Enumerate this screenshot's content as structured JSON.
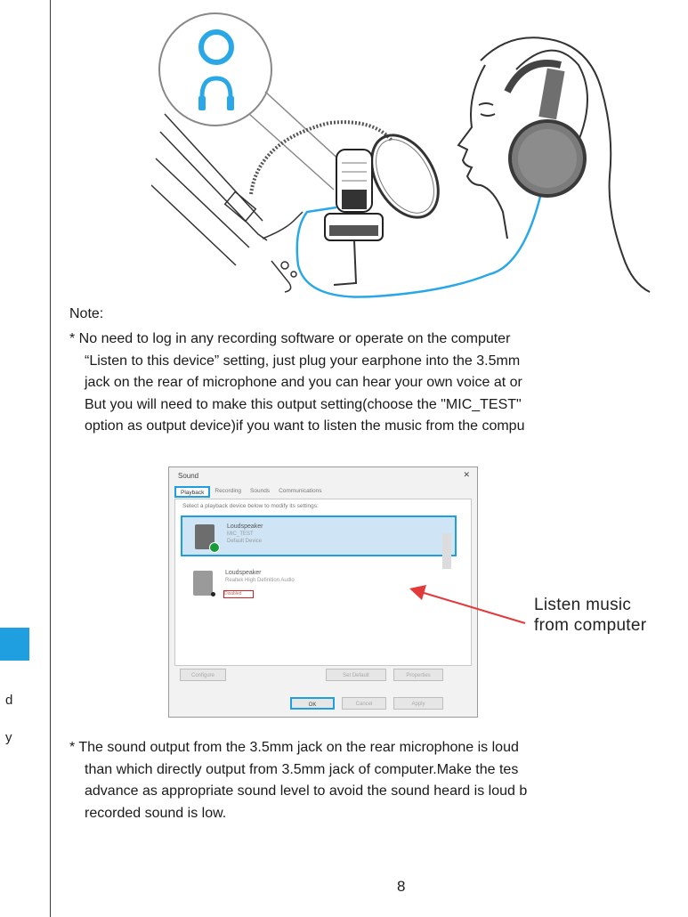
{
  "left_column": {
    "fragment_1": "d",
    "fragment_2": "y"
  },
  "note_heading": "Note:",
  "note_lines": [
    "* No need to log in any recording software or operate on the computer",
    "“Listen to this device” setting, just plug your earphone into the 3.5mm",
    "jack on the rear of microphone and you can hear your own voice at or",
    "But you will need to make this output setting(choose the \"MIC_TEST\"",
    "option as output device)if you want to listen the music from the compu"
  ],
  "dialog": {
    "title": "Sound",
    "close": "✕",
    "tabs": [
      "Playback",
      "Recording",
      "Sounds",
      "Communications"
    ],
    "instruction": "Select a playback device below to modify its settings:",
    "devices": [
      {
        "name": "Loudspeaker",
        "line2": "MIC_TEST",
        "line3": "Default Device"
      },
      {
        "name": "Loudspeaker",
        "line2": "Realtek High Definition Audio",
        "line3": "Disabled"
      }
    ],
    "buttons": {
      "configure": "Configure",
      "set_default": "Set Default",
      "properties": "Properties",
      "ok": "OK",
      "cancel": "Cancel",
      "apply": "Apply"
    }
  },
  "callout": [
    "Listen music",
    "from computer"
  ],
  "note2_lines": [
    "* The sound output from the 3.5mm jack on the rear microphone is loud",
    "than which directly output from 3.5mm jack of computer.Make the tes",
    "advance as appropriate sound level to avoid the sound heard is loud b",
    "recorded sound is low."
  ],
  "page_number": "8",
  "colors": {
    "accent_blue": "#1f9fe0",
    "arrow_red": "#e23a3a",
    "cable_blue": "#2aa7e6"
  }
}
